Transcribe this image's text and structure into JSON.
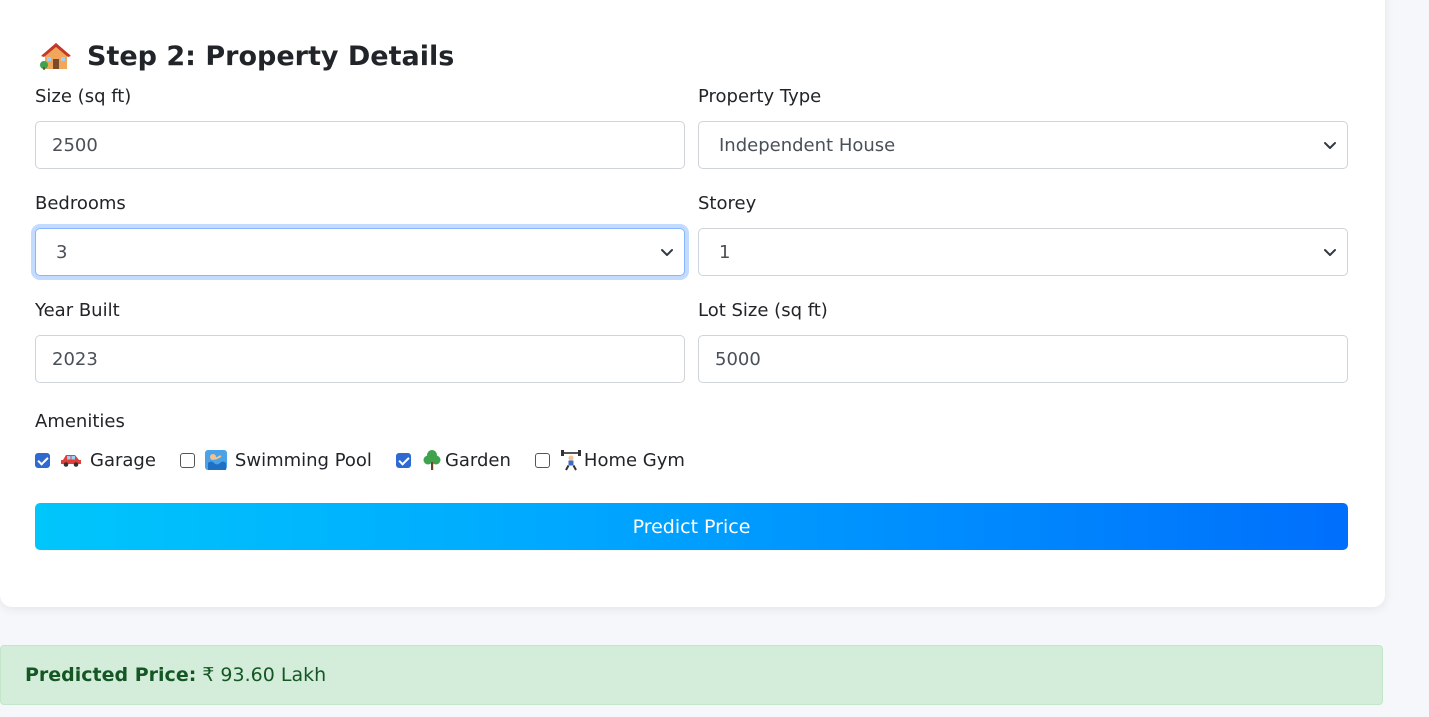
{
  "step": {
    "title": "Step 2: Property Details",
    "title_icon": "house-icon"
  },
  "fields": {
    "size": {
      "label": "Size (sq ft)",
      "value": "2500"
    },
    "property_type": {
      "label": "Property Type",
      "value": "Independent House"
    },
    "bedrooms": {
      "label": "Bedrooms",
      "value": "3"
    },
    "storey": {
      "label": "Storey",
      "value": "1"
    },
    "year_built": {
      "label": "Year Built",
      "value": "2023"
    },
    "lot_size": {
      "label": "Lot Size (sq ft)",
      "value": "5000"
    }
  },
  "amenities": {
    "label": "Amenities",
    "items": [
      {
        "label": "Garage",
        "icon": "car-icon",
        "checked": true
      },
      {
        "label": "Swimming Pool",
        "icon": "swimmer-icon",
        "checked": false
      },
      {
        "label": "Garden",
        "icon": "tree-icon",
        "checked": true
      },
      {
        "label": "Home Gym",
        "icon": "weightlifter-icon",
        "checked": false
      }
    ]
  },
  "predict_button": {
    "label": "Predict Price"
  },
  "result": {
    "label": "Predicted Price:",
    "value": "₹ 93.60 Lakh"
  },
  "colors": {
    "button_start": "#00c6fb",
    "button_end": "#006ffc",
    "result_bg": "#d4edda",
    "result_text": "#155724",
    "checkbox_checked": "#2f6ad0"
  }
}
